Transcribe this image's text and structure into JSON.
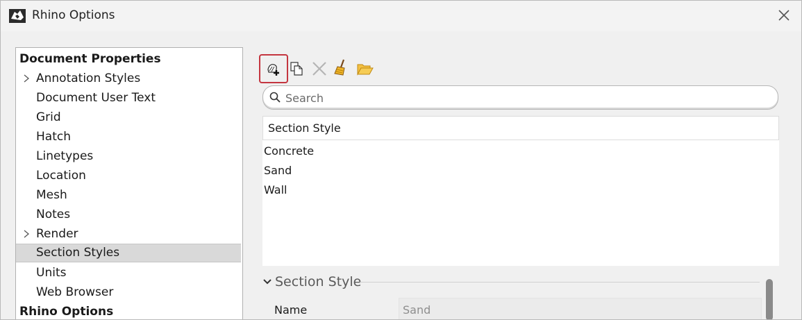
{
  "window": {
    "title": "Rhino Options"
  },
  "tree": {
    "items": [
      {
        "label": "Document Properties",
        "type": "header"
      },
      {
        "label": "Annotation Styles",
        "expandable": true
      },
      {
        "label": "Document User Text"
      },
      {
        "label": "Grid"
      },
      {
        "label": "Hatch"
      },
      {
        "label": "Linetypes"
      },
      {
        "label": "Location"
      },
      {
        "label": "Mesh"
      },
      {
        "label": "Notes"
      },
      {
        "label": "Render",
        "expandable": true
      },
      {
        "label": "Section Styles",
        "selected": true
      },
      {
        "label": "Units"
      },
      {
        "label": "Web Browser"
      },
      {
        "label": "Rhino Options",
        "type": "header"
      }
    ]
  },
  "toolbar": {
    "buttons": [
      {
        "name": "new-section-style-icon"
      },
      {
        "name": "copy-icon"
      },
      {
        "name": "delete-icon"
      },
      {
        "name": "broom-icon"
      },
      {
        "name": "folder-open-icon"
      }
    ],
    "highlight_color": "#c4353f"
  },
  "search": {
    "placeholder": "Search"
  },
  "list": {
    "header": "Section Style",
    "rows": [
      "Concrete",
      "Sand",
      "Wall"
    ]
  },
  "properties": {
    "section_title": "Section Style",
    "name_label": "Name",
    "name_value": "Sand"
  }
}
